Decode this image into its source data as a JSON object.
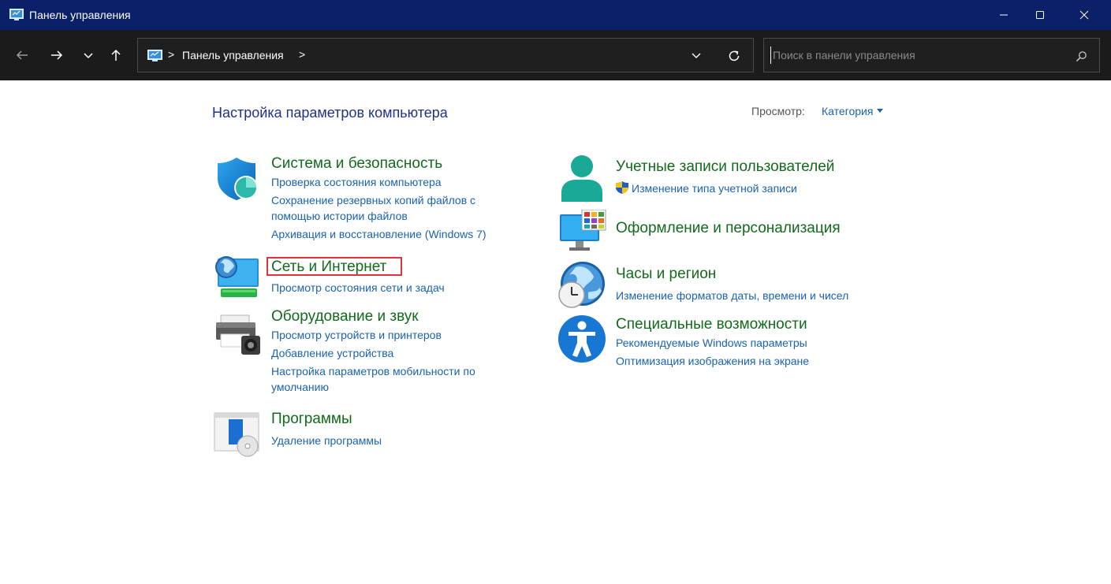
{
  "window": {
    "title": "Панель управления"
  },
  "address_bar": {
    "crumb": "Панель управления",
    "separator": ">"
  },
  "search": {
    "placeholder": "Поиск в панели управления"
  },
  "content": {
    "heading": "Настройка параметров компьютера",
    "view_label": "Просмотр:",
    "view_value": "Категория"
  },
  "categories": {
    "system": {
      "title": "Система и безопасность",
      "links": [
        "Проверка состояния компьютера",
        "Сохранение резервных копий файлов с",
        "помощью истории файлов",
        "Архивация и восстановление (Windows 7)"
      ]
    },
    "network": {
      "title": "Сеть и Интернет",
      "links": [
        "Просмотр состояния сети и задач"
      ]
    },
    "hardware": {
      "title": "Оборудование и звук",
      "links": [
        "Просмотр устройств и принтеров",
        "Добавление устройства",
        "Настройка параметров мобильности по",
        "умолчанию"
      ]
    },
    "programs": {
      "title": "Программы",
      "links": [
        "Удаление программы"
      ]
    },
    "accounts": {
      "title": "Учетные записи пользователей",
      "links": [
        "Изменение типа учетной записи"
      ]
    },
    "appearance": {
      "title": "Оформление и персонализация",
      "links": []
    },
    "clock": {
      "title": "Часы и регион",
      "links": [
        "Изменение форматов даты, времени и чисел"
      ]
    },
    "accessibility": {
      "title": "Специальные возможности",
      "links": [
        "Рекомендуемые Windows параметры",
        "Оптимизация изображения на экране"
      ]
    }
  },
  "colors": {
    "titlebar": "#0b2069",
    "navbar": "#1b1b1b",
    "category_title": "#116b1b",
    "link": "#1b62b0",
    "heading": "#1e3287",
    "highlight": "#e0333a"
  },
  "icons": {
    "app": "control-panel-icon",
    "system": "shield-icon",
    "network": "network-globe-icon",
    "hardware": "printer-icon",
    "programs": "programs-disc-icon",
    "accounts": "user-icon",
    "appearance": "monitor-palette-icon",
    "clock": "clock-globe-icon",
    "accessibility": "accessibility-icon",
    "uac": "uac-shield-icon"
  }
}
